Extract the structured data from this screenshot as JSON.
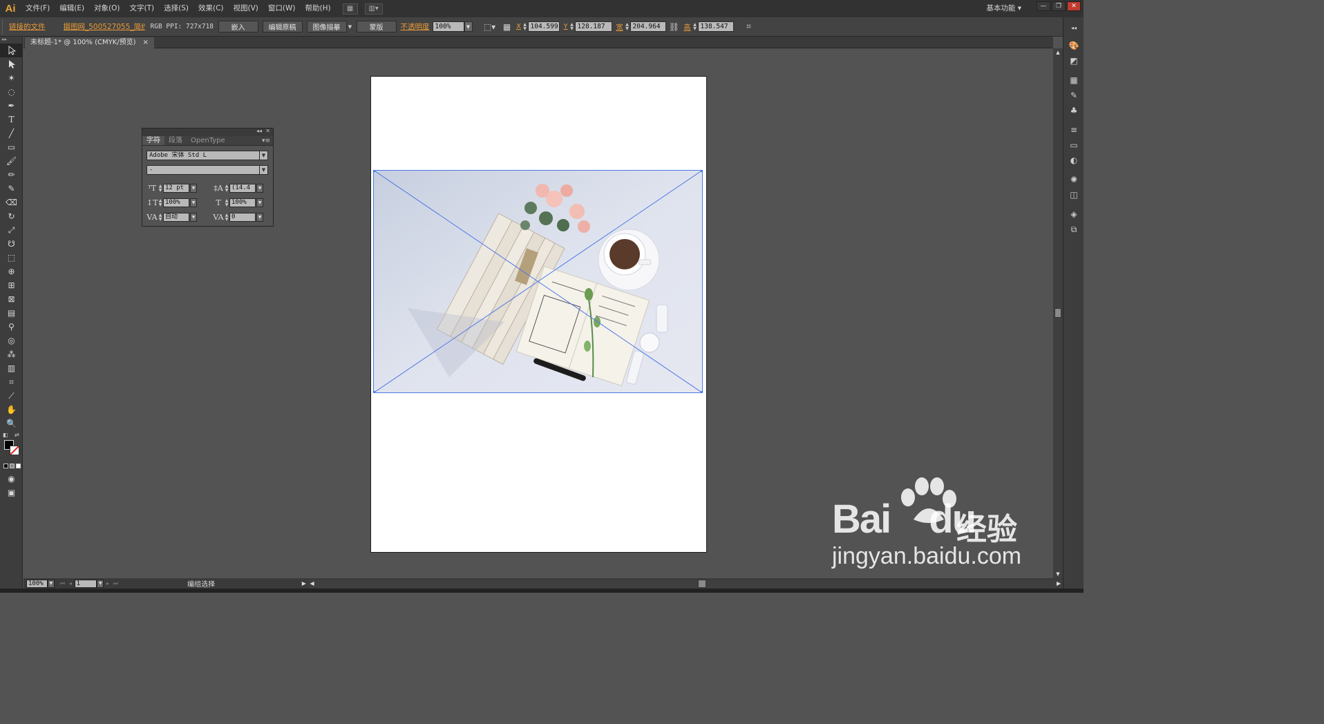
{
  "app": {
    "logo": "Ai",
    "workspace": "基本功能",
    "workspace_arrow": "▾"
  },
  "menu": {
    "items": [
      {
        "label": "文件(F)"
      },
      {
        "label": "编辑(E)"
      },
      {
        "label": "对象(O)"
      },
      {
        "label": "文字(T)"
      },
      {
        "label": "选择(S)"
      },
      {
        "label": "效果(C)"
      },
      {
        "label": "视图(V)"
      },
      {
        "label": "窗口(W)"
      },
      {
        "label": "帮助(H)"
      }
    ]
  },
  "window_controls": {
    "minimize": "—",
    "restore": "❐",
    "close": "✕"
  },
  "control_bar": {
    "linked_file_label": "链接的文件",
    "file_name": "摄图网_500527055_简约...",
    "color_info": "RGB PPI: 727x718",
    "embed_button": "嵌入",
    "edit_original_button": "编辑原稿",
    "image_trace_button": "图像描摹",
    "mask_button": "蒙版",
    "opacity_label": "不透明度",
    "opacity_value": "100%",
    "x_label": "X",
    "x_value": "104.599",
    "y_label": "Y",
    "y_value": "128.187",
    "w_label": "宽",
    "w_value": "204.964",
    "h_label": "高",
    "h_value": "138.547"
  },
  "document": {
    "tab_title": "未标题-1* @ 100% (CMYK/预览)",
    "tab_close": "×"
  },
  "character_panel": {
    "tabs": [
      {
        "label": "字符"
      },
      {
        "label": "段落"
      },
      {
        "label": "OpenType"
      }
    ],
    "font_family": "Adobe 宋体 Std L",
    "font_style": "-",
    "font_size": "12 pt",
    "leading": "(14.4",
    "vertical_scale": "100%",
    "horizontal_scale": "100%",
    "kerning": "自动",
    "tracking": "0"
  },
  "status_bar": {
    "zoom": "100%",
    "artboard": "1",
    "status_text": "编组选择"
  },
  "watermark": {
    "brand": "Bai",
    "brand_suffix": "du",
    "brand_cn": "经验",
    "url": "jingyan.baidu.com"
  }
}
